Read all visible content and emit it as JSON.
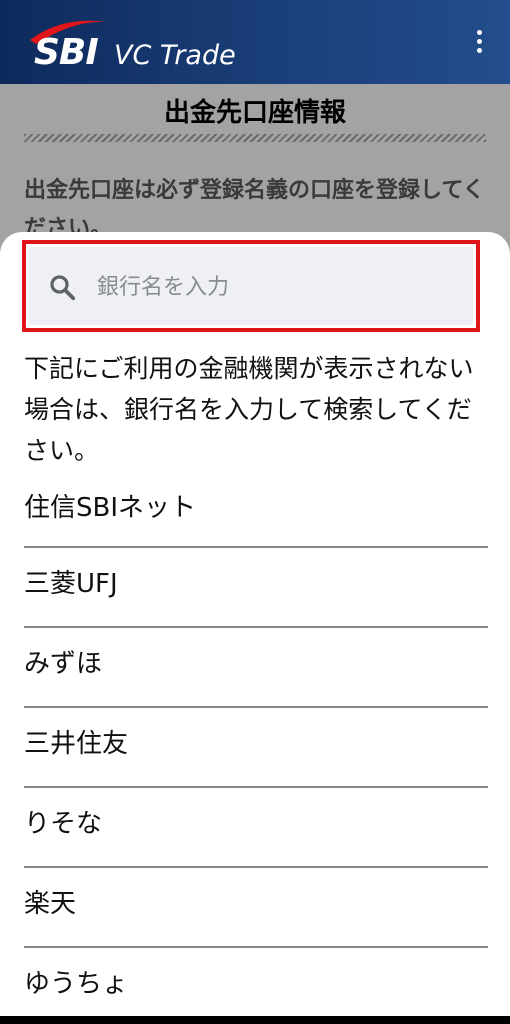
{
  "header": {
    "logo_text_sbi": "SBI",
    "logo_text_vc": "VC Trade",
    "menu_icon": "kebab-menu-icon",
    "background_color": "#1b3f7a"
  },
  "page": {
    "title": "出金先口座情報",
    "notice": "出金先口座は必ず登録名義の口座を登録してください。"
  },
  "sheet": {
    "search": {
      "placeholder": "銀行名を入力",
      "value": "",
      "icon": "search-icon",
      "highlight_color": "#e0161b"
    },
    "help_text": "下記にご利用の金融機関が表示されない場合は、銀行名を入力して検索してください。",
    "banks": [
      {
        "label": "住信SBIネット"
      },
      {
        "label": "三菱UFJ"
      },
      {
        "label": "みずほ"
      },
      {
        "label": "三井住友"
      },
      {
        "label": "りそな"
      },
      {
        "label": "楽天"
      },
      {
        "label": "ゆうちょ"
      }
    ]
  }
}
